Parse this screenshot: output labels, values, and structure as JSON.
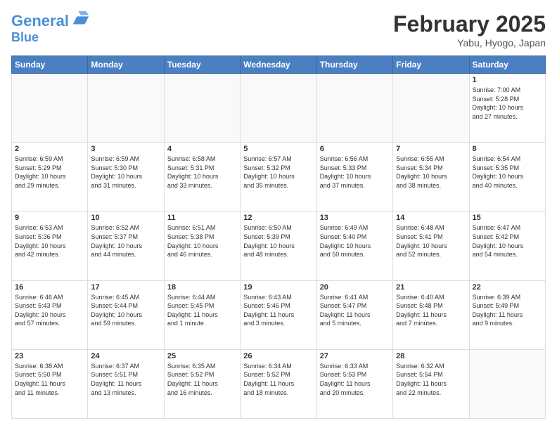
{
  "header": {
    "logo_line1": "General",
    "logo_line2": "Blue",
    "title": "February 2025",
    "subtitle": "Yabu, Hyogo, Japan"
  },
  "calendar": {
    "weekdays": [
      "Sunday",
      "Monday",
      "Tuesday",
      "Wednesday",
      "Thursday",
      "Friday",
      "Saturday"
    ],
    "weeks": [
      [
        {
          "day": "",
          "info": ""
        },
        {
          "day": "",
          "info": ""
        },
        {
          "day": "",
          "info": ""
        },
        {
          "day": "",
          "info": ""
        },
        {
          "day": "",
          "info": ""
        },
        {
          "day": "",
          "info": ""
        },
        {
          "day": "1",
          "info": "Sunrise: 7:00 AM\nSunset: 5:28 PM\nDaylight: 10 hours\nand 27 minutes."
        }
      ],
      [
        {
          "day": "2",
          "info": "Sunrise: 6:59 AM\nSunset: 5:29 PM\nDaylight: 10 hours\nand 29 minutes."
        },
        {
          "day": "3",
          "info": "Sunrise: 6:59 AM\nSunset: 5:30 PM\nDaylight: 10 hours\nand 31 minutes."
        },
        {
          "day": "4",
          "info": "Sunrise: 6:58 AM\nSunset: 5:31 PM\nDaylight: 10 hours\nand 33 minutes."
        },
        {
          "day": "5",
          "info": "Sunrise: 6:57 AM\nSunset: 5:32 PM\nDaylight: 10 hours\nand 35 minutes."
        },
        {
          "day": "6",
          "info": "Sunrise: 6:56 AM\nSunset: 5:33 PM\nDaylight: 10 hours\nand 37 minutes."
        },
        {
          "day": "7",
          "info": "Sunrise: 6:55 AM\nSunset: 5:34 PM\nDaylight: 10 hours\nand 38 minutes."
        },
        {
          "day": "8",
          "info": "Sunrise: 6:54 AM\nSunset: 5:35 PM\nDaylight: 10 hours\nand 40 minutes."
        }
      ],
      [
        {
          "day": "9",
          "info": "Sunrise: 6:53 AM\nSunset: 5:36 PM\nDaylight: 10 hours\nand 42 minutes."
        },
        {
          "day": "10",
          "info": "Sunrise: 6:52 AM\nSunset: 5:37 PM\nDaylight: 10 hours\nand 44 minutes."
        },
        {
          "day": "11",
          "info": "Sunrise: 6:51 AM\nSunset: 5:38 PM\nDaylight: 10 hours\nand 46 minutes."
        },
        {
          "day": "12",
          "info": "Sunrise: 6:50 AM\nSunset: 5:39 PM\nDaylight: 10 hours\nand 48 minutes."
        },
        {
          "day": "13",
          "info": "Sunrise: 6:49 AM\nSunset: 5:40 PM\nDaylight: 10 hours\nand 50 minutes."
        },
        {
          "day": "14",
          "info": "Sunrise: 6:48 AM\nSunset: 5:41 PM\nDaylight: 10 hours\nand 52 minutes."
        },
        {
          "day": "15",
          "info": "Sunrise: 6:47 AM\nSunset: 5:42 PM\nDaylight: 10 hours\nand 54 minutes."
        }
      ],
      [
        {
          "day": "16",
          "info": "Sunrise: 6:46 AM\nSunset: 5:43 PM\nDaylight: 10 hours\nand 57 minutes."
        },
        {
          "day": "17",
          "info": "Sunrise: 6:45 AM\nSunset: 5:44 PM\nDaylight: 10 hours\nand 59 minutes."
        },
        {
          "day": "18",
          "info": "Sunrise: 6:44 AM\nSunset: 5:45 PM\nDaylight: 11 hours\nand 1 minute."
        },
        {
          "day": "19",
          "info": "Sunrise: 6:43 AM\nSunset: 5:46 PM\nDaylight: 11 hours\nand 3 minutes."
        },
        {
          "day": "20",
          "info": "Sunrise: 6:41 AM\nSunset: 5:47 PM\nDaylight: 11 hours\nand 5 minutes."
        },
        {
          "day": "21",
          "info": "Sunrise: 6:40 AM\nSunset: 5:48 PM\nDaylight: 11 hours\nand 7 minutes."
        },
        {
          "day": "22",
          "info": "Sunrise: 6:39 AM\nSunset: 5:49 PM\nDaylight: 11 hours\nand 9 minutes."
        }
      ],
      [
        {
          "day": "23",
          "info": "Sunrise: 6:38 AM\nSunset: 5:50 PM\nDaylight: 11 hours\nand 11 minutes."
        },
        {
          "day": "24",
          "info": "Sunrise: 6:37 AM\nSunset: 5:51 PM\nDaylight: 11 hours\nand 13 minutes."
        },
        {
          "day": "25",
          "info": "Sunrise: 6:35 AM\nSunset: 5:52 PM\nDaylight: 11 hours\nand 16 minutes."
        },
        {
          "day": "26",
          "info": "Sunrise: 6:34 AM\nSunset: 5:52 PM\nDaylight: 11 hours\nand 18 minutes."
        },
        {
          "day": "27",
          "info": "Sunrise: 6:33 AM\nSunset: 5:53 PM\nDaylight: 11 hours\nand 20 minutes."
        },
        {
          "day": "28",
          "info": "Sunrise: 6:32 AM\nSunset: 5:54 PM\nDaylight: 11 hours\nand 22 minutes."
        },
        {
          "day": "",
          "info": ""
        }
      ]
    ]
  }
}
